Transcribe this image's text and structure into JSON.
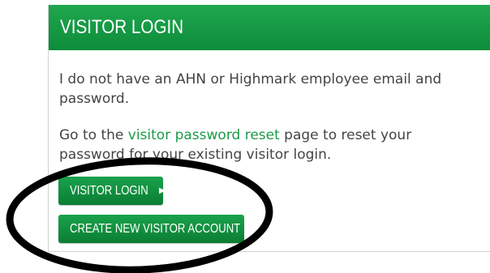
{
  "card": {
    "title": "VISITOR LOGIN"
  },
  "body": {
    "para1": "I do not have an AHN or Highmark employee email and password.",
    "para2_prefix": "Go to the ",
    "para2_link": "visitor password reset",
    "para2_suffix": " page to reset your password for your existing visitor login."
  },
  "buttons": {
    "visitor_login": "VISITOR LOGIN",
    "create_account": "CREATE NEW VISITOR ACCOUNT",
    "caret_icon": "caret-right-icon"
  },
  "colors": {
    "header_green": "#149a43",
    "link_green": "#1c9a48",
    "button_green": "#0f8e3e",
    "annotation_ellipse": "#000000"
  }
}
